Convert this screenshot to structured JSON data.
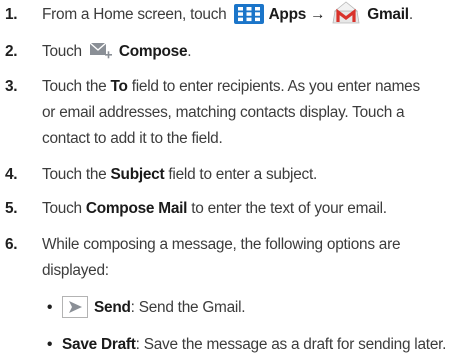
{
  "steps": [
    {
      "num": "1.",
      "t1": "From a Home screen, touch",
      "apps": "Apps",
      "arrow": "→",
      "gmail": "Gmail",
      "end": "."
    },
    {
      "num": "2.",
      "t1": "Touch",
      "compose": "Compose",
      "end": "."
    },
    {
      "num": "3.",
      "t1": "Touch the",
      "to": "To",
      "t2": "field to enter recipients. As you enter names",
      "l2": "or email addresses, matching contacts display. Touch a",
      "l3": "contact to add it to the field."
    },
    {
      "num": "4.",
      "t1": "Touch the",
      "subject": "Subject",
      "t2": "field to enter a subject."
    },
    {
      "num": "5.",
      "t1": "Touch",
      "compose_mail": "Compose Mail",
      "t2": "to enter the text of your email."
    },
    {
      "num": "6.",
      "l1": "While composing a message, the following options are",
      "l2": "displayed:"
    }
  ],
  "options": [
    {
      "bullet": "•",
      "label": "Send",
      "desc": ": Send the Gmail."
    },
    {
      "bullet": "•",
      "label": "Save Draft",
      "desc": ": Save the message as a draft for sending later."
    }
  ],
  "icons": {
    "apps": "apps-grid-icon",
    "gmail": "gmail-envelope-icon",
    "compose": "compose-mail-icon",
    "send": "send-arrow-icon"
  },
  "colors": {
    "apps_blue": "#1b75c9",
    "gmail_red": "#d9322b",
    "icon_gray": "#8a8f96"
  }
}
